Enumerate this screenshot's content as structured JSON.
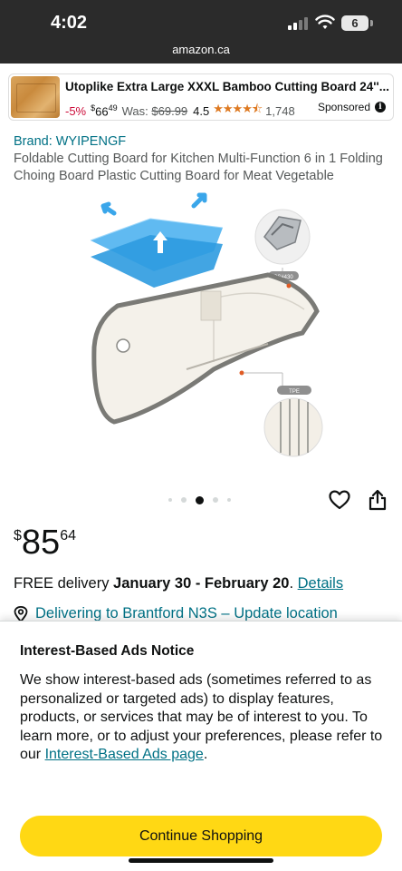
{
  "status_bar": {
    "time": "4:02",
    "battery": "6",
    "url": "amazon.ca"
  },
  "sponsored_ad": {
    "title": "Utoplike Extra Large XXXL Bamboo Cutting Board 24''...",
    "discount": "-5%",
    "price_symbol": "$",
    "price_whole": "66",
    "price_fraction": "49",
    "was_label": "Was:",
    "was_price": "$69.99",
    "rating": "4.5",
    "stars": "★★★★⯪",
    "review_count": "1,748",
    "sponsored_label": "Sponsored",
    "info_icon": "i"
  },
  "product": {
    "brand": "Brand: WYIPENGF",
    "title": "Foldable Cutting Board for Kitchen Multi-Function 6 in 1 Folding Choing Board Plastic Cutting Board for Meat Vegetable",
    "image_labels": {
      "material_top": "SS#430",
      "material_bottom": "TPE"
    },
    "carousel_dots": 5,
    "carousel_active_index": 2,
    "price": {
      "currency": "$",
      "whole": "85",
      "fraction": "64"
    },
    "delivery": {
      "prefix": "FREE delivery ",
      "dates": "January 30 - February 20",
      "suffix": ". ",
      "details_link": "Details"
    },
    "location": "Delivering to Brantford N3S – Update location"
  },
  "ads_notice": {
    "title": "Interest-Based Ads Notice",
    "body": "We show interest-based ads (sometimes referred to as personalized or targeted ads) to display features, products, or services that may be of interest to you. To learn more, or to adjust your preferences, please refer to our ",
    "link": "Interest-Based Ads page",
    "body_end": ".",
    "button": "Continue Shopping"
  },
  "icons": {
    "heart": "heart-icon",
    "share": "share-icon",
    "pin": "location-pin-icon"
  },
  "colors": {
    "status_bar_bg": "#2b2b2b",
    "link": "#007185",
    "discount": "#cc0c39",
    "stars": "#de7921",
    "button": "#ffd814"
  }
}
